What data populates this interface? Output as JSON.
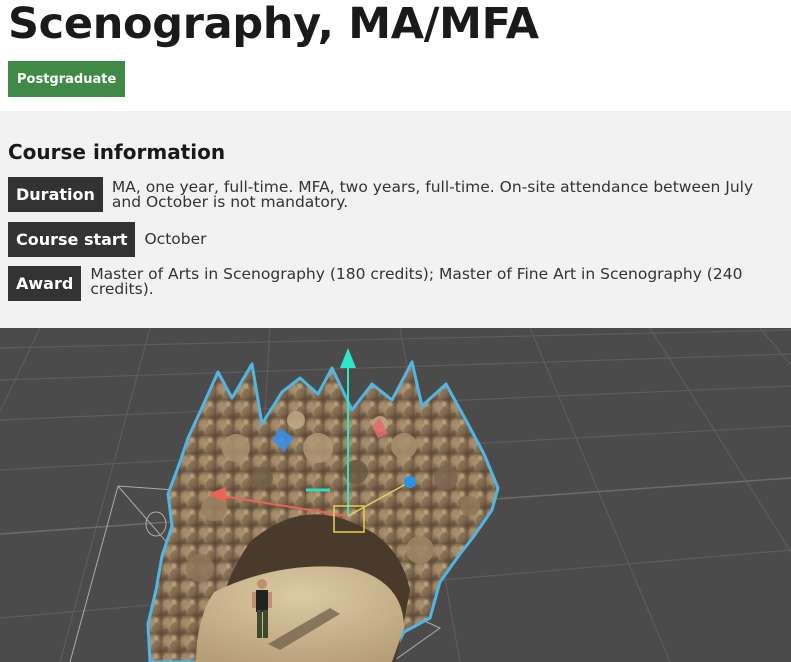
{
  "page": {
    "title": "Scenography, MA/MFA",
    "level_badge": "Postgraduate"
  },
  "course_info": {
    "heading": "Course information",
    "rows": [
      {
        "label": "Duration",
        "value": "MA, one year, full-time. MFA, two years, full-time. On-site attendance between July and October is not mandatory."
      },
      {
        "label": "Course start",
        "value": "October"
      },
      {
        "label": "Award",
        "value": "Master of Arts in Scenography (180 credits); Master of Fine Art in Scenography (240 credits)."
      }
    ]
  },
  "hero_image": {
    "subject": "3D viewport render of a rocky sandstone cave model with a human figure and transform gizmo",
    "colors": {
      "background": "#4c4c4c",
      "grid": "#5e5e5e",
      "rock": "#9c8466",
      "outline": "#4fb6e6",
      "gizmo_x": "#e8655a",
      "gizmo_y": "#2ee0c0",
      "gizmo_z": "#2ee6c8",
      "badge_green": "#3f8a46"
    }
  }
}
